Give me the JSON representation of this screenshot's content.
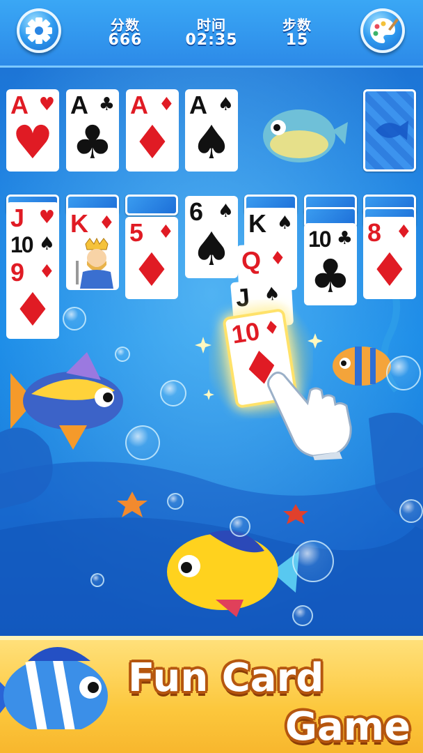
{
  "hud": {
    "settings_icon": "gear-icon",
    "theme_icon": "palette-icon",
    "score_label": "分数",
    "score_value": "666",
    "time_label": "时间",
    "time_value": "02:35",
    "moves_label": "步数",
    "moves_value": "15"
  },
  "foundations": [
    {
      "rank": "A",
      "suit": "♥",
      "color": "red"
    },
    {
      "rank": "A",
      "suit": "♣",
      "color": "black"
    },
    {
      "rank": "A",
      "suit": "♦",
      "color": "red"
    },
    {
      "rank": "A",
      "suit": "♠",
      "color": "black"
    }
  ],
  "tableau": {
    "col1": [
      {
        "rank": "J",
        "suit": "♥",
        "color": "red"
      },
      {
        "rank": "10",
        "suit": "♠",
        "color": "black"
      },
      {
        "rank": "9",
        "suit": "♦",
        "color": "red"
      }
    ],
    "col2": {
      "rank": "K",
      "suit": "♦",
      "color": "red"
    },
    "col3": {
      "rank": "5",
      "suit": "♦",
      "color": "red"
    },
    "col4": {
      "rank": "6",
      "suit": "♠",
      "color": "black"
    },
    "col5": [
      {
        "rank": "K",
        "suit": "♠",
        "color": "black"
      },
      {
        "rank": "Q",
        "suit": "♦",
        "color": "red"
      },
      {
        "rank": "J",
        "suit": "♠",
        "color": "black"
      }
    ],
    "col6": {
      "rank": "10",
      "suit": "♣",
      "color": "black"
    },
    "col7": {
      "rank": "8",
      "suit": "♦",
      "color": "red"
    }
  },
  "dragging_card": {
    "rank": "10",
    "suit": "♦",
    "color": "red"
  },
  "banner": {
    "line1": "Fun Card",
    "line2": "Game"
  },
  "colors": {
    "red_suit": "#e01b24",
    "black_suit": "#111111",
    "banner": "#fcc73c"
  }
}
